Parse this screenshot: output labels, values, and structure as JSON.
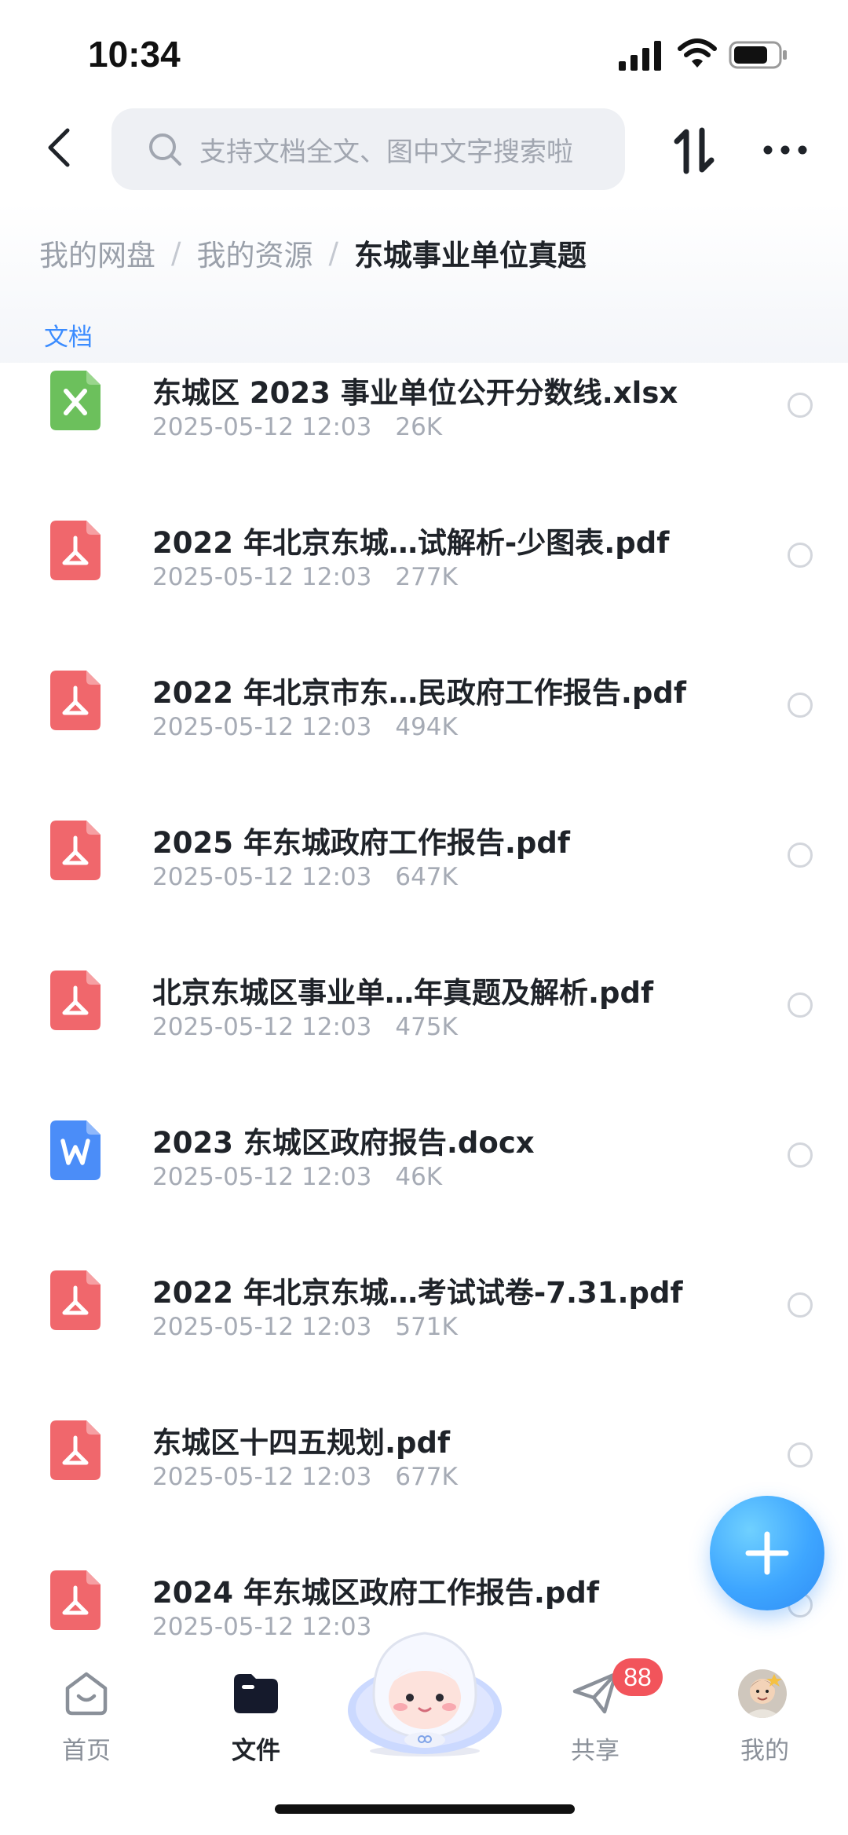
{
  "status_bar": {
    "time": "10:34"
  },
  "header": {
    "search_placeholder": "支持文档全文、图中文字搜索啦",
    "icons": {
      "back": "chevron-left-icon",
      "sort": "sort-icon",
      "more": "more-dots-icon"
    }
  },
  "breadcrumb": {
    "items": [
      "我的网盘",
      "我的资源"
    ],
    "separator": "/",
    "current": "东城事业单位真题"
  },
  "section": {
    "label": "文档"
  },
  "files": [
    {
      "type": "xlsx",
      "name": "东城区 2023 事业单位公开分数线.xlsx",
      "date": "2025-05-12 12:03",
      "size": "26K"
    },
    {
      "type": "pdf",
      "name": "2022 年北京东城…试解析-少图表.pdf",
      "date": "2025-05-12 12:03",
      "size": "277K"
    },
    {
      "type": "pdf",
      "name": "2022 年北京市东…民政府工作报告.pdf",
      "date": "2025-05-12 12:03",
      "size": "494K"
    },
    {
      "type": "pdf",
      "name": "2025 年东城政府工作报告.pdf",
      "date": "2025-05-12 12:03",
      "size": "647K"
    },
    {
      "type": "pdf",
      "name": "北京东城区事业单…年真题及解析.pdf",
      "date": "2025-05-12 12:03",
      "size": "475K"
    },
    {
      "type": "docx",
      "name": "2023 东城区政府报告.docx",
      "date": "2025-05-12 12:03",
      "size": "46K"
    },
    {
      "type": "pdf",
      "name": "2022 年北京东城…考试试卷-7.31.pdf",
      "date": "2025-05-12 12:03",
      "size": "571K"
    },
    {
      "type": "pdf",
      "name": "东城区十四五规划.pdf",
      "date": "2025-05-12 12:03",
      "size": "677K"
    },
    {
      "type": "pdf",
      "name": "2024 年东城区政府工作报告.pdf",
      "date": "2025-05-12 12:03",
      "size": ""
    }
  ],
  "tab_bar": {
    "tabs": [
      {
        "label": "首页",
        "icon": "home-icon",
        "active": false
      },
      {
        "label": "文件",
        "icon": "folder-icon",
        "active": true
      },
      {
        "label": "共享",
        "icon": "share-plane-icon",
        "active": false
      },
      {
        "label": "我的",
        "icon": "avatar",
        "active": false
      }
    ],
    "share_badge": "88"
  },
  "colors": {
    "accent": "#3b8cff",
    "pdf": "#f0676c",
    "xlsx": "#6cc05c",
    "docx": "#4b8df8",
    "badge": "#f2545b"
  }
}
